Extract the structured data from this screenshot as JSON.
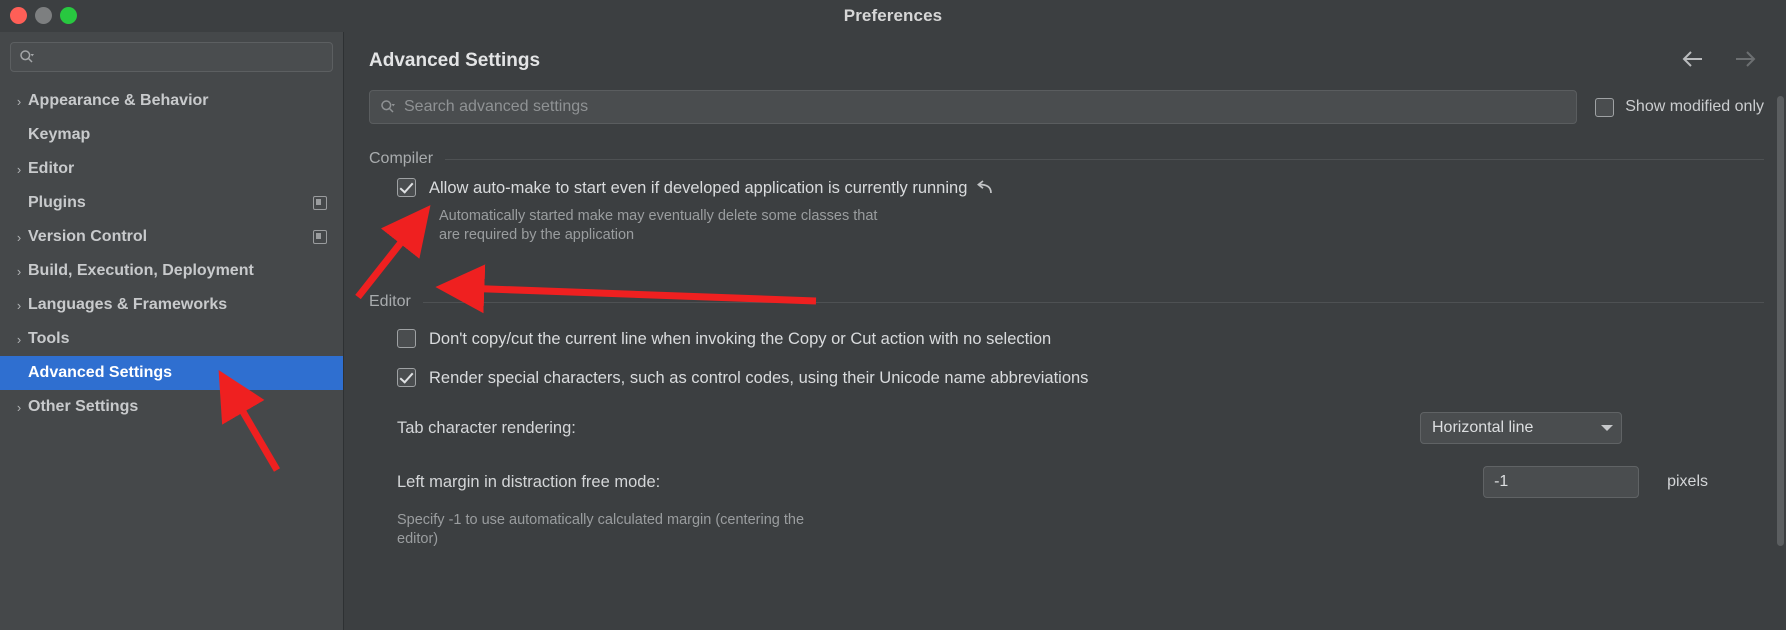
{
  "window": {
    "title": "Preferences",
    "traffic_lights": [
      "close-red",
      "minimize-amber",
      "zoom-green"
    ]
  },
  "sidebar": {
    "search": {
      "value": "",
      "placeholder": ""
    },
    "items": [
      {
        "label": "Appearance & Behavior",
        "expandable": true,
        "selected": false,
        "badge": false
      },
      {
        "label": "Keymap",
        "expandable": false,
        "selected": false,
        "badge": false
      },
      {
        "label": "Editor",
        "expandable": true,
        "selected": false,
        "badge": false
      },
      {
        "label": "Plugins",
        "expandable": false,
        "selected": false,
        "badge": true
      },
      {
        "label": "Version Control",
        "expandable": true,
        "selected": false,
        "badge": true
      },
      {
        "label": "Build, Execution, Deployment",
        "expandable": true,
        "selected": false,
        "badge": false
      },
      {
        "label": "Languages & Frameworks",
        "expandable": true,
        "selected": false,
        "badge": false
      },
      {
        "label": "Tools",
        "expandable": true,
        "selected": false,
        "badge": false
      },
      {
        "label": "Advanced Settings",
        "expandable": false,
        "selected": true,
        "badge": false
      },
      {
        "label": "Other Settings",
        "expandable": true,
        "selected": false,
        "badge": false
      }
    ]
  },
  "main": {
    "page_title": "Advanced Settings",
    "nav": {
      "back": "←",
      "forward": "→"
    },
    "search": {
      "value": "",
      "placeholder": "Search advanced settings"
    },
    "show_modified": {
      "label": "Show modified only",
      "checked": false
    },
    "sections": [
      {
        "title": "Compiler",
        "options": [
          {
            "label": "Allow auto-make to start even if developed application is currently running",
            "checked": true,
            "revert_icon": "revert-arrow-icon",
            "description_line1": "Automatically started make may eventually delete some classes that",
            "description_line2": "are required by the application"
          }
        ]
      },
      {
        "title": "Editor",
        "options": [
          {
            "label": "Don't copy/cut the current line when invoking the Copy or Cut action with no selection",
            "checked": false
          },
          {
            "label": "Render special characters, such as control codes, using their Unicode name abbreviations",
            "checked": true
          }
        ],
        "fields": [
          {
            "type": "combo",
            "label": "Tab character rendering:",
            "value": "Horizontal line"
          },
          {
            "type": "number",
            "label": "Left margin in distraction free mode:",
            "value": "-1",
            "unit": "pixels",
            "hint_line1": "Specify -1 to use automatically calculated margin (centering the",
            "hint_line2": "editor)"
          }
        ]
      }
    ]
  },
  "annotations": {
    "accent_color": "#ef2020",
    "arrows": [
      "arrow-to-compiler-checkbox",
      "arrow-to-compiler-description",
      "arrow-to-advanced-settings-item"
    ]
  },
  "colors": {
    "window_bg": "#3c3f41",
    "sidebar_bg": "#45484a",
    "selection_blue": "#2f6fd0",
    "text_primary": "#d9dbdd",
    "text_secondary": "#9a9d9f"
  }
}
